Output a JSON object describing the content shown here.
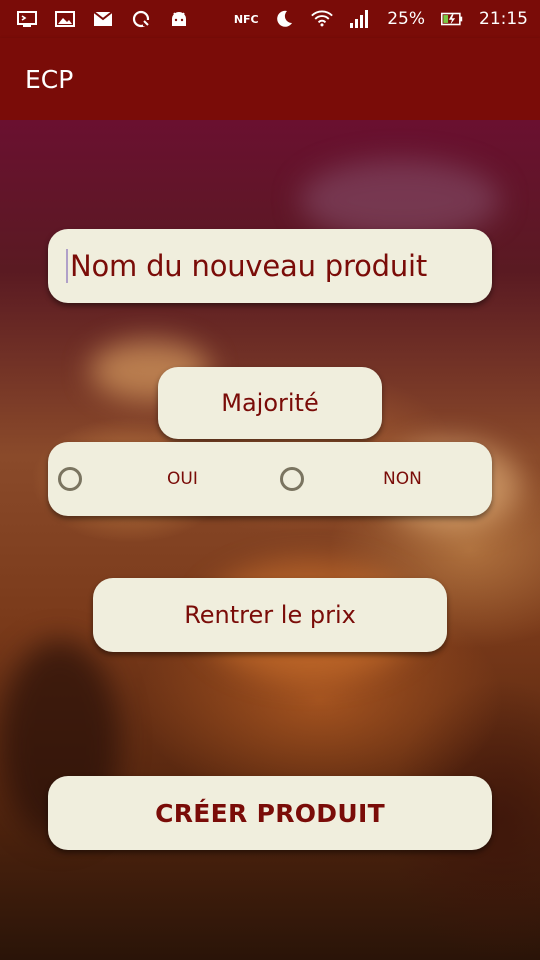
{
  "status_bar": {
    "nfc_label": "NFC",
    "battery": "25%",
    "time": "21:15",
    "icons": [
      "usb-debug-icon",
      "image-icon",
      "gmail-icon",
      "sync-icon",
      "android-icon",
      "nfc-icon",
      "moon-icon",
      "wifi-icon",
      "signal-icon",
      "battery-charging-icon"
    ]
  },
  "app_bar": {
    "title": "ECP"
  },
  "form": {
    "product_name_value": "Nom du nouveau produit",
    "majority_label": "Majorité",
    "radio_yes": "OUI",
    "radio_no": "NON",
    "price_label": "Rentrer le prix",
    "create_button": "CRÉER PRODUIT"
  },
  "colors": {
    "primary": "#7a0c08",
    "panel": "#f0eedd",
    "text": "#7a0c08"
  }
}
